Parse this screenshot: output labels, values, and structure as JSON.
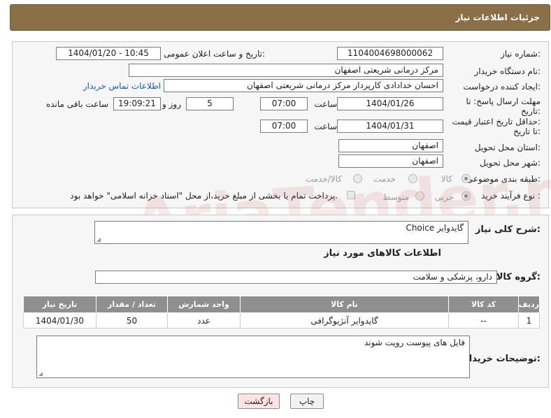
{
  "header": {
    "title": "جزئیات اطلاعات نیاز"
  },
  "form": {
    "need_number_label": "شماره نیاز:",
    "need_number": "1104004698000062",
    "announce_label": "تاریخ و ساعت اعلان عمومی:",
    "announce_value": "1404/01/20 - 10:45",
    "buyer_org_label": "نام دستگاه خریدار:",
    "buyer_org": "مرکز درمانی شریعتی اصفهان",
    "creator_label": "ایجاد کننده درخواست:",
    "creator": "احسان خدادادی کارپرداز مرکز درمانی شریعتی اصفهان",
    "contact_link": "اطلاعات تماس خریدار",
    "deadline_label_1": "مهلت ارسال پاسخ: تا",
    "deadline_label_2": "تاریخ:",
    "deadline_date": "1404/01/26",
    "time_label": "ساعت",
    "deadline_time": "07:00",
    "days_value": "5",
    "days_label": "روز و",
    "remaining_time": "19:09:21",
    "remaining_label": "ساعت باقی مانده",
    "validity_label_1": "حداقل تاریخ اعتبار قیمت:",
    "validity_label_2": "تا تاریخ:",
    "validity_date": "1404/01/31",
    "validity_time": "07:00",
    "province_label": "استان محل تحویل:",
    "province": "اصفهان",
    "city_label": "شهر محل تحویل:",
    "city": "اصفهان",
    "category_label": "طبقه بندی موضوعی:",
    "category_options": [
      "کالا",
      "خدمت",
      "کالا/خدمت"
    ],
    "process_label": "نوع فرآیند خرید :",
    "process_options": [
      "جزیی",
      "متوسط"
    ],
    "payment_note": "پرداخت تمام یا بخشی از مبلغ خرید،از محل \"اسناد خزانه اسلامی\" خواهد بود."
  },
  "details": {
    "desc_label": "شرح کلی نیاز:",
    "desc_value": "گایدوایر Choice",
    "goods_info_title": "اطلاعات کالاهای مورد نیاز",
    "group_label": "گروه کالا:",
    "group_value": "دارو، پزشکی و سلامت",
    "table_headers": [
      "ردیف",
      "کد کالا",
      "نام کالا",
      "واحد شمارش",
      "تعداد / مقدار",
      "تاریخ نیاز"
    ],
    "rows": [
      {
        "row": "1",
        "code": "--",
        "name": "گایدوایر آنژیوگرافی",
        "unit": "عدد",
        "qty": "50",
        "date": "1404/01/30"
      }
    ],
    "buyer_notes_label": "توضیحات خریدار:",
    "buyer_notes": "فایل های پیوست رویت شوند"
  },
  "buttons": {
    "print": "چاپ",
    "back": "بازگشت"
  },
  "watermark": "AriaTender.neT"
}
